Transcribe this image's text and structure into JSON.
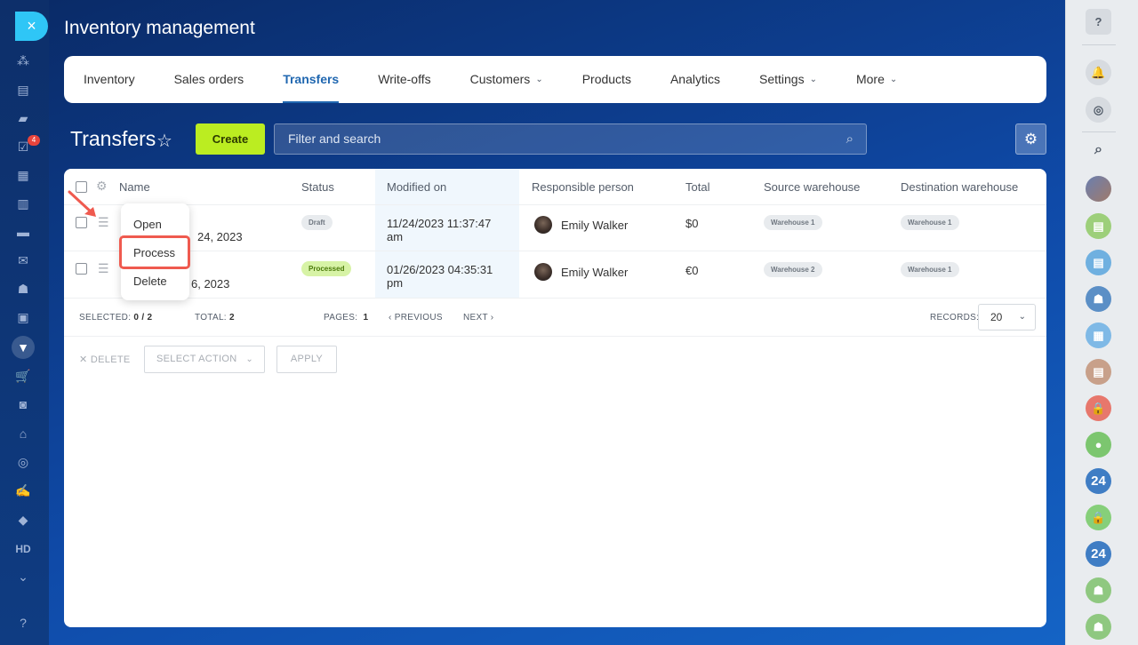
{
  "app": {
    "title": "Inventory management"
  },
  "left_sidebar": {
    "close_label": "×",
    "badge_count": "4",
    "hd_label": "HD"
  },
  "nav": {
    "tabs": [
      {
        "label": "Inventory",
        "active": false,
        "dropdown": false
      },
      {
        "label": "Sales orders",
        "active": false,
        "dropdown": false
      },
      {
        "label": "Transfers",
        "active": true,
        "dropdown": false
      },
      {
        "label": "Write-offs",
        "active": false,
        "dropdown": false
      },
      {
        "label": "Customers",
        "active": false,
        "dropdown": true
      },
      {
        "label": "Products",
        "active": false,
        "dropdown": false
      },
      {
        "label": "Analytics",
        "active": false,
        "dropdown": false
      },
      {
        "label": "Settings",
        "active": false,
        "dropdown": true
      },
      {
        "label": "More",
        "active": false,
        "dropdown": true
      }
    ]
  },
  "toolbar": {
    "page_title": "Transfers",
    "create_label": "Create",
    "search_placeholder": "Filter and search"
  },
  "grid": {
    "columns": {
      "name": "Name",
      "status": "Status",
      "modified": "Modified on",
      "responsible": "Responsible person",
      "total": "Total",
      "source": "Source warehouse",
      "destination": "Destination warehouse"
    },
    "rows": [
      {
        "name_fragment": "24, 2023",
        "status": "Draft",
        "status_color": "#e8ebee",
        "modified_line1": "11/24/2023 11:37:47",
        "modified_line2": "am",
        "responsible": "Emily Walker",
        "total": "$0",
        "source": "Warehouse 1",
        "destination": "Warehouse 1"
      },
      {
        "name_fragment": "6, 2023",
        "status": "Processed",
        "status_color": "#d7f3a6",
        "modified_line1": "01/26/2023 04:35:31",
        "modified_line2": "pm",
        "responsible": "Emily Walker",
        "total": "€0",
        "source": "Warehouse 2",
        "destination": "Warehouse 1"
      }
    ]
  },
  "footer": {
    "selected_label": "SELECTED:",
    "selected_value": "0 / 2",
    "total_label": "TOTAL:",
    "total_value": "2",
    "pages_label": "PAGES:",
    "pages_value": "1",
    "previous_label": "PREVIOUS",
    "next_label": "NEXT",
    "records_label": "RECORDS:",
    "records_value": "20"
  },
  "actions": {
    "delete_label": "DELETE",
    "select_action_label": "SELECT ACTION",
    "apply_label": "APPLY"
  },
  "context_menu": {
    "items": [
      "Open",
      "Process",
      "Delete"
    ],
    "highlighted": "Process",
    "highlight_color": "#ef5a4f"
  },
  "right_sidebar": {
    "badge_24": "24"
  }
}
